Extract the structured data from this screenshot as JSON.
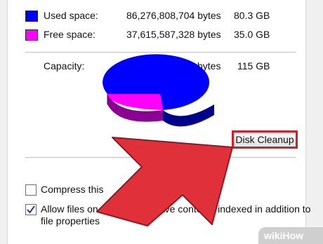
{
  "used": {
    "label": "Used space:",
    "bytes": "86,276,808,704 bytes",
    "size": "80.3 GB",
    "color": "#0000ff"
  },
  "free": {
    "label": "Free space:",
    "bytes": "37,615,587,328 bytes",
    "size": "35.0 GB",
    "color": "#ff00ff"
  },
  "capacity": {
    "label": "Capacity:",
    "bytes": "123,892,396,032 bytes",
    "size": "115 GB"
  },
  "disk_cleanup": {
    "label": "Disk Cleanup",
    "highlight_color": "#d0202c"
  },
  "compress": {
    "label": "Compress this",
    "checked": false
  },
  "index": {
    "label_line1": "Allow files on this drive to have contents indexed in addition to",
    "label_line2": "file properties",
    "checked": true
  },
  "overlay_arrow_color": "#e0303a",
  "watermark": "wikiHow"
}
